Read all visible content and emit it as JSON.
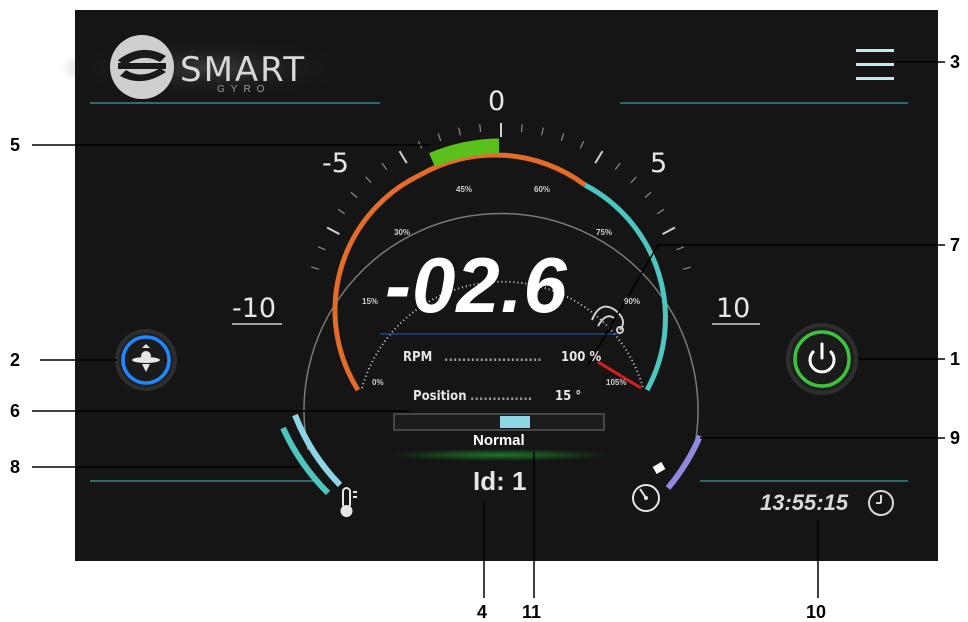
{
  "app": {
    "logo_word": "SMART",
    "logo_sub": "GYRO"
  },
  "gauge": {
    "value": "-02.6",
    "scale": {
      "zero": "0",
      "neg5": "-5",
      "pos5": "5",
      "neg10": "-10",
      "pos10": "10"
    },
    "percent_labels": [
      "0%",
      "15%",
      "30%",
      "45%",
      "60%",
      "75%",
      "90%",
      "105%"
    ]
  },
  "readouts": {
    "rpm_label": "RPM",
    "rpm_value": "100 %",
    "position_label": "Position",
    "position_value": "15 °"
  },
  "status": {
    "mode": "Normal",
    "id": "Id: 1",
    "time": "13:55:15"
  },
  "callouts": [
    "1",
    "2",
    "3",
    "4",
    "5",
    "6",
    "7",
    "8",
    "9",
    "10",
    "11"
  ],
  "colors": {
    "accent_teal": "#4ec6c0",
    "orange": "#e36c2b",
    "green": "#5ac11c",
    "power_green": "#3cc43c",
    "blue_ring": "#1e88ff",
    "lavender": "#8f8ae0"
  },
  "icons": [
    "logo-icon",
    "menu-icon",
    "gyro-icon",
    "power-icon",
    "thermometer-icon",
    "speed-icon",
    "clock-icon",
    "rpm-icon"
  ]
}
